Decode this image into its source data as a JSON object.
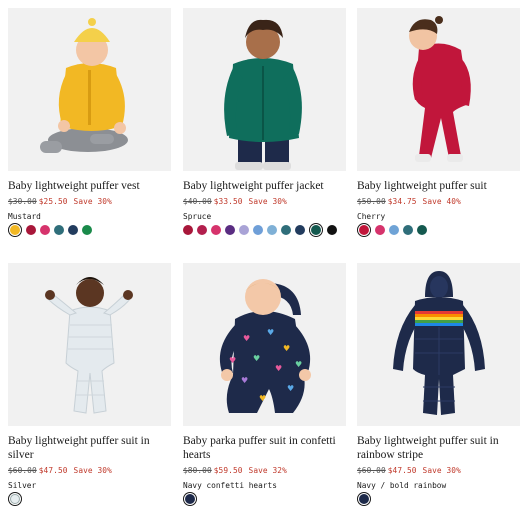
{
  "products": [
    {
      "title": "Baby lightweight puffer vest",
      "was": "$30.00",
      "now": "$25.50",
      "save": "Save 30%",
      "color_name": "Mustard",
      "swatches": [
        "#f2b824",
        "#a8173a",
        "#d6336c",
        "#2f6e7a",
        "#223c5e",
        "#1a8a4a"
      ],
      "selected": 0,
      "photo": "baby-in-yellow-vest"
    },
    {
      "title": "Baby lightweight puffer jacket",
      "was": "$40.00",
      "now": "$33.50",
      "save": "Save 30%",
      "color_name": "Spruce",
      "swatches": [
        "#a8173a",
        "#b21f4d",
        "#d6336c",
        "#5a2d82",
        "#a9a3d6",
        "#6f9fd8",
        "#7fb0d6",
        "#2f6e7a",
        "#223c5e",
        "#14594f",
        "#111111"
      ],
      "selected": 9,
      "photo": "toddler-in-green-jacket"
    },
    {
      "title": "Baby lightweight puffer suit",
      "was": "$50.00",
      "now": "$34.75",
      "save": "Save 40%",
      "color_name": "Cherry",
      "swatches": [
        "#c1163b",
        "#d6336c",
        "#6fa3d6",
        "#2f6e7a",
        "#14594f"
      ],
      "selected": 0,
      "photo": "toddler-in-red-suit"
    },
    {
      "title": "Baby lightweight puffer suit in silver",
      "was": "$60.00",
      "now": "$47.50",
      "save": "Save 30%",
      "color_name": "Silver",
      "swatches": [
        "#e7eef0"
      ],
      "selected": 0,
      "photo": "baby-in-silver-suit"
    },
    {
      "title": "Baby parka puffer suit in confetti hearts",
      "was": "$80.00",
      "now": "$59.50",
      "save": "Save 32%",
      "color_name": "Navy confetti hearts",
      "swatches": [
        "#1e2a4a"
      ],
      "selected": 0,
      "photo": "baby-in-navy-hearts-suit"
    },
    {
      "title": "Baby lightweight puffer suit in rainbow stripe",
      "was": "$60.00",
      "now": "$47.50",
      "save": "Save 30%",
      "color_name": "Navy / bold rainbow",
      "swatches": [
        "#1e2a4a"
      ],
      "selected": 0,
      "photo": "navy-rainbow-suit"
    }
  ]
}
